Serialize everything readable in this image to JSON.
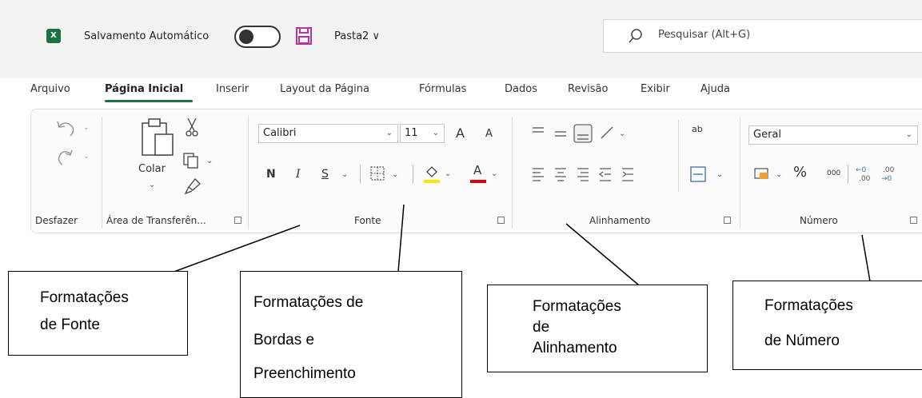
{
  "titlebar": {
    "app_icon": "X",
    "autosave_label": "Salvamento Automático",
    "file_name": "Pasta2 ∨",
    "search_placeholder": "Pesquisar (Alt+G)"
  },
  "tabs": [
    "Arquivo",
    "Página Inicial",
    "Inserir",
    "Layout da Página",
    "Fórmulas",
    "Dados",
    "Revisão",
    "Exibir",
    "Ajuda"
  ],
  "active_tab": "Página Inicial",
  "ribbon": {
    "clipboard": {
      "paste_label": "Colar"
    },
    "font": {
      "name": "Calibri",
      "size": "11",
      "bold": "N",
      "italic": "I",
      "underline": "S",
      "grow": "A",
      "shrink": "A",
      "color": "A"
    },
    "number": {
      "format": "Geral",
      "percent": "%",
      "thousands": "000",
      "increase_decimal": "←0\n.00",
      "decrease_decimal": ".00\n→0"
    },
    "wrap_text_glyph": "ab",
    "group_labels": {
      "undo": "Desfazer",
      "clipboard": "Área de Transferên...",
      "font": "Fonte",
      "alignment": "Alinhamento",
      "number": "Número"
    }
  },
  "annotations": {
    "font": [
      "Formatações",
      "de Fonte"
    ],
    "borders": [
      "Formatações de",
      "Bordas e",
      "Preenchimento"
    ],
    "alignment": [
      "Formatações",
      "de",
      "Alinhamento"
    ],
    "number": [
      "Formatações",
      "de Número"
    ]
  },
  "colors": {
    "excel_green": "#1e7145",
    "highlight_yellow": "#ffe600",
    "font_red": "#e00000",
    "save_icon": "#b4379b"
  }
}
